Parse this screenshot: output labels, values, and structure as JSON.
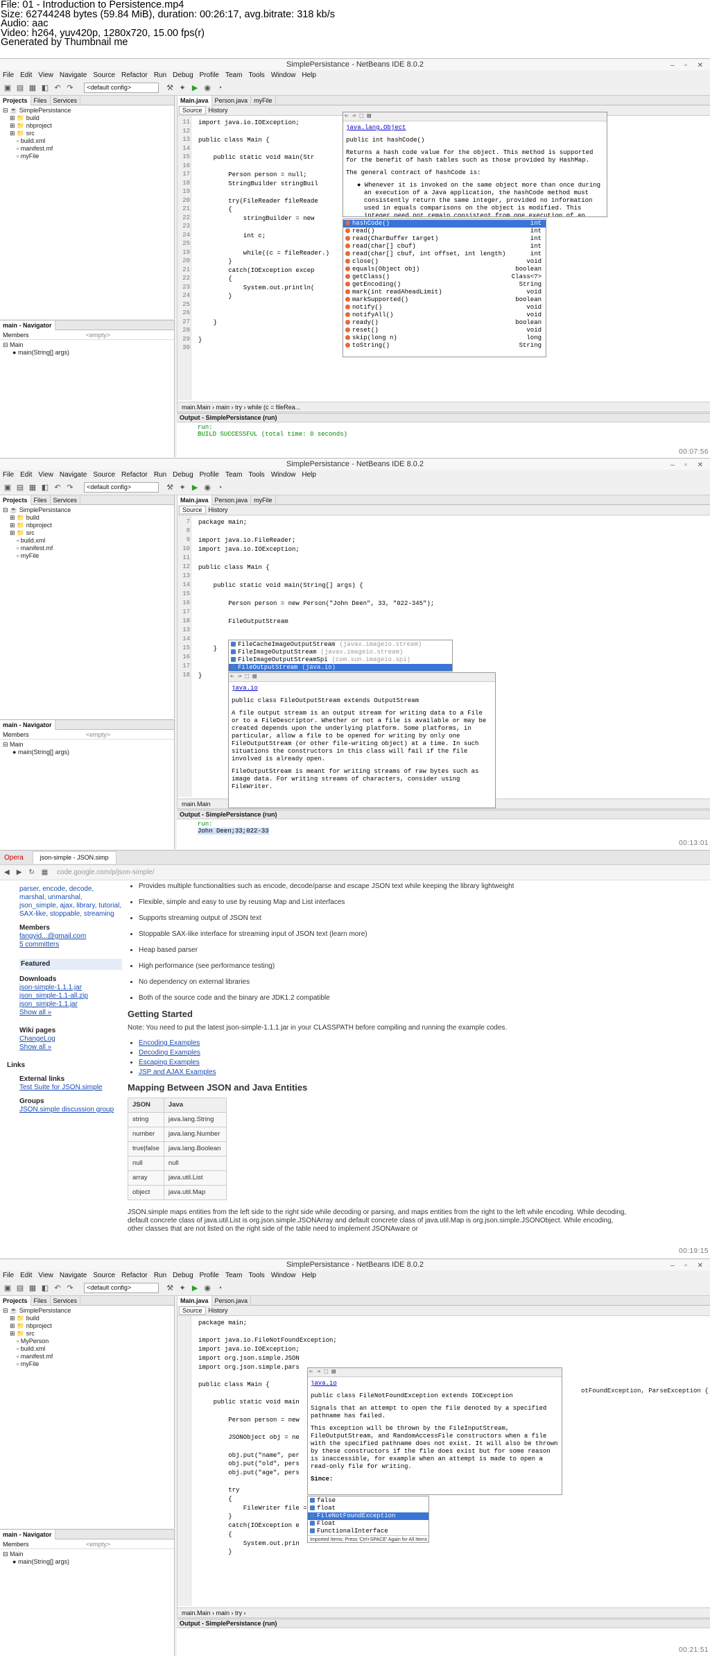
{
  "header": {
    "lines": [
      "File: 01 - Introduction to Persistence.mp4",
      "Size: 62744248 bytes (59.84 MiB), duration: 00:26:17, avg.bitrate: 318 kb/s",
      "Audio: aac",
      "Video: h264, yuv420p, 1280x720, 15.00 fps(r)",
      "Generated by Thumbnail me"
    ]
  },
  "ide": {
    "title": "SimplePersistance - NetBeans IDE 8.0.2",
    "window_controls": "–  ▫  ✕",
    "menu": [
      "File",
      "Edit",
      "View",
      "Navigate",
      "Source",
      "Refactor",
      "Run",
      "Debug",
      "Profile",
      "Team",
      "Tools",
      "Window",
      "Help"
    ],
    "config": "<default config>",
    "left_tabs": [
      "Projects",
      "Files",
      "Services"
    ],
    "tree": [
      "SimplePersistance",
      "build",
      "nbproject",
      "src",
      "build.xml",
      "manifest.mf",
      "myFile"
    ],
    "tree4": [
      "SimplePersistance",
      "build",
      "nbproject",
      "src",
      "MyPerson",
      "build.xml",
      "manifest.mf",
      "myFile"
    ],
    "navigator": "main - Navigator",
    "members": "Members",
    "empty": "<empty>",
    "nav_class": "Main",
    "nav_method": "main(String[] args)",
    "source_tab": "Source",
    "history_tab": "History",
    "output_title": "Output - SimplePersistance (run)",
    "output_run": "run:",
    "build_success": "BUILD SUCCESSFUL (total time: 0 seconds)",
    "output_john": "John Deen;33;022-33",
    "crumbs1": "main.Main  ›  main  ›  try  ›  while (c = fileRea...",
    "crumbs2": "main.Main",
    "crumbs4": "main.Main  ›  main  ›  try  ›"
  },
  "frame1": {
    "timestamp": "00:07:56",
    "tabs": [
      "Main.java",
      "Person.java",
      "myFile"
    ],
    "code": [
      {
        "n": "11",
        "t": "import java.io.IOException;"
      },
      {
        "n": "12",
        "t": ""
      },
      {
        "n": "13",
        "t": "public class Main {"
      },
      {
        "n": "14",
        "t": ""
      },
      {
        "n": "15",
        "t": "    public static void main(Str"
      },
      {
        "n": "16",
        "t": ""
      },
      {
        "n": "17",
        "t": "        Person person = null;"
      },
      {
        "n": "18",
        "t": "        StringBuilder stringBuil"
      },
      {
        "n": "19",
        "t": ""
      },
      {
        "n": "20",
        "t": "        try(FileReader fileReade"
      },
      {
        "n": "21",
        "t": "        {"
      },
      {
        "n": "22",
        "t": "            stringBuilder = new"
      },
      {
        "n": "23",
        "t": ""
      },
      {
        "n": "24",
        "t": "            int c;"
      },
      {
        "n": "25",
        "t": ""
      },
      {
        "n": "19",
        "t": "            while((c = fileReader.)"
      },
      {
        "n": "20",
        "t": "        }"
      },
      {
        "n": "21",
        "t": "        catch(IOException excep"
      },
      {
        "n": "22",
        "t": "        {"
      },
      {
        "n": "23",
        "t": "            System.out.println("
      },
      {
        "n": "24",
        "t": "        }"
      },
      {
        "n": "25",
        "t": ""
      },
      {
        "n": "26",
        "t": ""
      },
      {
        "n": "27",
        "t": "    }"
      },
      {
        "n": "28",
        "t": ""
      },
      {
        "n": "29",
        "t": "}"
      },
      {
        "n": "30",
        "t": ""
      }
    ],
    "doc": {
      "pkg": "java.lang.Object",
      "sig": "public int hashCode()",
      "p1": "Returns a hash code value for the object. This method is supported for the benefit of hash tables such as those provided by HashMap.",
      "p2": "The general contract of hashCode is:",
      "p3": "Whenever it is invoked on the same object more than once during an execution of a Java application, the hashCode method must consistently return the same integer, provided no information used in equals comparisons on the object is modified. This integer need not remain consistent from one execution of an"
    },
    "completions": [
      {
        "m": "hashCode()",
        "t": "int"
      },
      {
        "m": "read()",
        "t": "int"
      },
      {
        "m": "read(CharBuffer target)",
        "t": "int"
      },
      {
        "m": "read(char[] cbuf)",
        "t": "int"
      },
      {
        "m": "read(char[] cbuf, int offset, int length)",
        "t": "int"
      },
      {
        "m": "close()",
        "t": "void"
      },
      {
        "m": "equals(Object obj)",
        "t": "boolean"
      },
      {
        "m": "getClass()",
        "t": "Class<?>"
      },
      {
        "m": "getEncoding()",
        "t": "String"
      },
      {
        "m": "mark(int readAheadLimit)",
        "t": "void"
      },
      {
        "m": "markSupported()",
        "t": "boolean"
      },
      {
        "m": "notify()",
        "t": "void"
      },
      {
        "m": "notifyAll()",
        "t": "void"
      },
      {
        "m": "ready()",
        "t": "boolean"
      },
      {
        "m": "reset()",
        "t": "void"
      },
      {
        "m": "skip(long n)",
        "t": "long"
      },
      {
        "m": "toString()",
        "t": "String"
      }
    ]
  },
  "frame2": {
    "timestamp": "00:13:01",
    "tabs": [
      "Main.java",
      "Person.java",
      "myFile"
    ],
    "code": [
      {
        "n": "7",
        "t": "package main;"
      },
      {
        "n": "8",
        "t": ""
      },
      {
        "n": "9",
        "t": "import java.io.FileReader;"
      },
      {
        "n": "10",
        "t": "import java.io.IOException;"
      },
      {
        "n": "11",
        "t": ""
      },
      {
        "n": "12",
        "t": "public class Main {"
      },
      {
        "n": "13",
        "t": ""
      },
      {
        "n": "14",
        "t": "    public static void main(String[] args) {"
      },
      {
        "n": "15",
        "t": ""
      },
      {
        "n": "16",
        "t": "        Person person = new Person(\"John Deen\", 33, \"022-345\");"
      },
      {
        "n": "17",
        "t": ""
      },
      {
        "n": "18",
        "t": "        FileOutputStream"
      },
      {
        "n": "13",
        "t": ""
      },
      {
        "n": "14",
        "t": ""
      },
      {
        "n": "15",
        "t": "    }"
      },
      {
        "n": "16",
        "t": ""
      },
      {
        "n": "17",
        "t": ""
      },
      {
        "n": "18",
        "t": "}"
      }
    ],
    "completions": [
      {
        "m": "FileCacheImageOutputStream",
        "p": "(javax.imageio.stream)"
      },
      {
        "m": "FileImageOutputStream",
        "p": "(javax.imageio.stream)"
      },
      {
        "m": "FileImageOutputStreamSpi",
        "p": "(com.sun.imageio.spi)"
      },
      {
        "m": "FileOutputStream",
        "p": "(java.io)"
      }
    ],
    "doc": {
      "pkg": "java.io",
      "sig": "public class FileOutputStream extends OutputStream",
      "p1": "A file output stream is an output stream for writing data to a File or to a FileDescriptor. Whether or not a file is available or may be created depends upon the underlying platform. Some platforms, in particular, allow a file to be opened for writing by only one FileOutputStream (or other file-writing object) at a time. In such situations the constructors in this class will fail if the file involved is already open.",
      "p2": "FileOutputStream is meant for writing streams of raw bytes such as image data. For writing streams of characters, consider using FileWriter."
    }
  },
  "browser": {
    "timestamp": "00:19:15",
    "tab": "json-simple - JSON.simp",
    "opera": "Opera",
    "address": "code.google.com/p/json-simple/",
    "side_tags": "parser, encode, decode, marshal, unmarshal, json_simple, ajax, library, tutorial, SAX-like, stoppable, streaming",
    "members_h": "Members",
    "member1": "fangyid...@gmail.com",
    "member2": "5 committers",
    "featured": "Featured",
    "downloads_h": "Downloads",
    "dl": [
      "json-simple-1.1.1.jar",
      "json_simple-1.1-all.zip",
      "json_simple-1.1.jar",
      "Show all »"
    ],
    "wiki_h": "Wiki pages",
    "wiki": [
      "ChangeLog",
      "Show all »"
    ],
    "links_h": "Links",
    "ext_h": "External links",
    "ext": "Test Suite for JSON.simple",
    "groups_h": "Groups",
    "groups": "JSON.simple discussion group",
    "bullets": [
      "Provides multiple functionalities such as encode, decode/parse and escape JSON text while keeping the library lightweight",
      "Flexible, simple and easy to use by reusing Map and List interfaces",
      "Supports streaming output of JSON text",
      "Stoppable SAX-like interface for streaming input of JSON text (learn more)",
      "Heap based parser",
      "High performance (see performance testing)",
      "No dependency on external libraries",
      "Both of the source code and the binary are JDK1.2 compatible"
    ],
    "getting_started": "Getting Started",
    "note": "Note: You need to put the latest json-simple-1.1.1.jar in your CLASSPATH before compiling and running the example codes.",
    "examples": [
      "Encoding Examples",
      "Decoding Examples",
      "Escaping Examples",
      "JSP and AJAX Examples"
    ],
    "mapping_h": "Mapping Between JSON and Java Entities",
    "table_head": [
      "JSON",
      "Java"
    ],
    "table": [
      [
        "string",
        "java.lang.String"
      ],
      [
        "number",
        "java.lang.Number"
      ],
      [
        "true|false",
        "java.lang.Boolean"
      ],
      [
        "null",
        "null"
      ],
      [
        "array",
        "java.util.List"
      ],
      [
        "object",
        "java.util.Map"
      ]
    ],
    "para": "JSON.simple maps entities from the left side to the right side while decoding or parsing, and maps entities from the right to the left while encoding. While decoding, default concrete class of java.util.List is org.json.simple.JSONArray and default concrete class of java.util.Map is org.json.simple.JSONObject. While encoding, other classes that are not listed on the right side of the table need to implement JSONAware or"
  },
  "frame4": {
    "timestamp": "00:21:51",
    "tabs": [
      "Main.java",
      "Person.java"
    ],
    "code": [
      {
        "n": "",
        "t": "package main;"
      },
      {
        "n": "",
        "t": ""
      },
      {
        "n": "",
        "t": "import java.io.FileNotFoundException;"
      },
      {
        "n": "",
        "t": "import java.io.IOException;"
      },
      {
        "n": "",
        "t": "import org.json.simple.JSON"
      },
      {
        "n": "",
        "t": "import org.json.simple.pars"
      },
      {
        "n": "",
        "t": ""
      },
      {
        "n": "",
        "t": "public class Main {"
      },
      {
        "n": "",
        "t": ""
      },
      {
        "n": "",
        "t": "    public static void main"
      },
      {
        "n": "",
        "t": ""
      },
      {
        "n": "",
        "t": "        Person person = new"
      },
      {
        "n": "",
        "t": ""
      },
      {
        "n": "",
        "t": "        JSONObject obj = ne"
      },
      {
        "n": "",
        "t": ""
      },
      {
        "n": "",
        "t": "        obj.put(\"name\", per"
      },
      {
        "n": "",
        "t": "        obj.put(\"old\", pers"
      },
      {
        "n": "",
        "t": "        obj.put(\"age\", pers"
      },
      {
        "n": "",
        "t": ""
      },
      {
        "n": "",
        "t": "        try"
      },
      {
        "n": "",
        "t": "        {"
      },
      {
        "n": "",
        "t": "            FileWriter file = F"
      },
      {
        "n": "",
        "t": "        }"
      },
      {
        "n": "",
        "t": "        catch(IOException e"
      },
      {
        "n": "",
        "t": "        {"
      },
      {
        "n": "",
        "t": "            System.out.prin"
      },
      {
        "n": "",
        "t": "        }"
      }
    ],
    "throws": "otFoundException, ParseException {",
    "doc": {
      "pkg": "java.io",
      "sig": "public class FileNotFoundException extends IOException",
      "p1": "Signals that an attempt to open the file denoted by a specified pathname has failed.",
      "p2": "This exception will be thrown by the FileInputStream, FileOutputStream, and RandomAccessFile constructors when a file with the specified pathname does not exist. It will also be thrown by these constructors if the file does exist but for some reason is inaccessible, for example when an attempt is made to open a read-only file for writing.",
      "since": "Since:"
    },
    "completions": [
      "false",
      "float",
      "FileNotFoundException",
      "Float",
      "FunctionalInterface"
    ],
    "hint": "Imported Items; Press 'Ctrl+SPACE' Again for All Items"
  }
}
